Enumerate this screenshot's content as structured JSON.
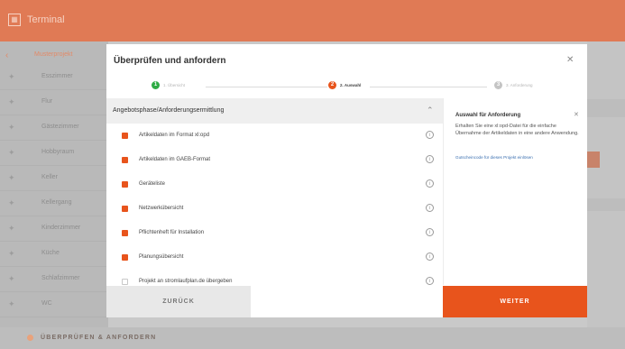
{
  "header": {
    "terminal_label": "Terminal",
    "terminal_icon": "terminal-icon"
  },
  "sidebar": {
    "project_label": "Musterprojekt",
    "items": [
      {
        "label": "Esszimmer"
      },
      {
        "label": "Flur"
      },
      {
        "label": "Gästezimmer"
      },
      {
        "label": "Hobbyraum"
      },
      {
        "label": "Keller"
      },
      {
        "label": "Kellergang"
      },
      {
        "label": "Kinderzimmer"
      },
      {
        "label": "Küche"
      },
      {
        "label": "Schlafzimmer"
      },
      {
        "label": "WC"
      }
    ]
  },
  "footer_bar": {
    "label": "ÜBERPRÜFEN & ANFORDERN"
  },
  "modal": {
    "title": "Überprüfen und anfordern",
    "close_icon": "close-icon",
    "steps": [
      {
        "number": "1",
        "label": "1. Übersicht",
        "state": "done"
      },
      {
        "number": "2",
        "label": "2. Auswahl",
        "state": "active"
      },
      {
        "number": "3",
        "label": "3. Anforderung",
        "state": "pending"
      }
    ],
    "section": {
      "title": "Angebotsphase/Anforderungsermittlung",
      "items": [
        {
          "label": "Artikeldaten im Format xl:opd",
          "checked": true
        },
        {
          "label": "Artikeldaten im GAEB-Format",
          "checked": true
        },
        {
          "label": "Geräteliste",
          "checked": true
        },
        {
          "label": "Netzwerkübersicht",
          "checked": true
        },
        {
          "label": "Pflichtenheft für Installation",
          "checked": true
        },
        {
          "label": "Planungsübersicht",
          "checked": true
        },
        {
          "label": "Projekt an stromlaufplan.de übergeben",
          "checked": false
        }
      ]
    },
    "info_panel": {
      "title": "Auswahl für Anforderung",
      "description": "Erhalten Sie eine xl:opd-Datei für die einfache Übernahme der Artikeldaten in eine andere Anwendung.",
      "link": "Gutscheincode für dieses Projekt einlösen"
    },
    "back_label": "ZURÜCK",
    "next_label": "WEITER"
  },
  "colors": {
    "accent": "#e8541c",
    "done": "#2eab44",
    "pending": "#c4c4c4",
    "header": "#e07a55"
  }
}
